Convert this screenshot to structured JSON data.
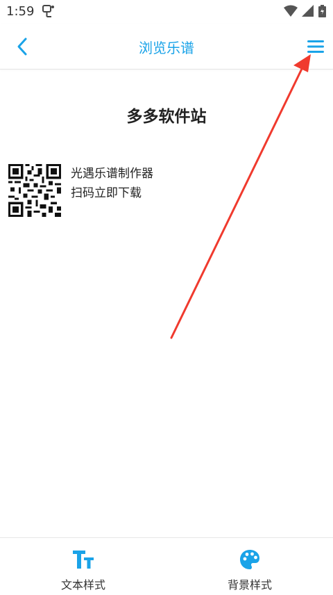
{
  "status": {
    "time": "1:59"
  },
  "header": {
    "title": "浏览乐谱"
  },
  "sheet": {
    "title": "多多软件站",
    "qr_line1": "光遇乐谱制作器",
    "qr_line2": "扫码立即下载"
  },
  "bottom_tabs": [
    {
      "label": "文本样式",
      "icon": "text-style-icon"
    },
    {
      "label": "背景样式",
      "icon": "palette-icon"
    }
  ],
  "colors": {
    "accent": "#1aa3e8",
    "arrow": "#f03a2e"
  }
}
